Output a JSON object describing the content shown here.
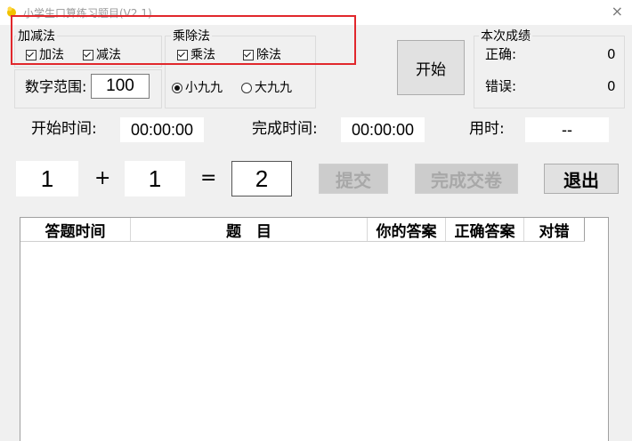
{
  "window": {
    "title": "小学生口算练习题目(V2.1)",
    "close_glyph": "×"
  },
  "addsub": {
    "label": "加减法",
    "add": "加法",
    "sub": "减法"
  },
  "muldiv": {
    "label": "乘除法",
    "mul": "乘法",
    "div": "除法",
    "small": "小九九",
    "big": "大九九"
  },
  "range": {
    "label": "数字范围:",
    "value": "100"
  },
  "start_button": "开始",
  "score": {
    "label": "本次成绩",
    "correct_label": "正确:",
    "correct_value": "0",
    "wrong_label": "错误:",
    "wrong_value": "0"
  },
  "times": {
    "start_label": "开始时间:",
    "start_value": "00:00:00",
    "end_label": "完成时间:",
    "end_value": "00:00:00",
    "used_label": "用时:",
    "used_value": "--"
  },
  "question": {
    "a": "1",
    "op": "+",
    "b": "1",
    "eq": "=",
    "answer": "2"
  },
  "buttons": {
    "submit": "提交",
    "finish": "完成交卷",
    "exit": "退出"
  },
  "table": {
    "columns": [
      "答题时间",
      "题　目",
      "你的答案",
      "正确答案",
      "对错"
    ],
    "rows": []
  },
  "colors": {
    "highlight": "#e1272c",
    "window_bg": "#f0f0f0"
  }
}
